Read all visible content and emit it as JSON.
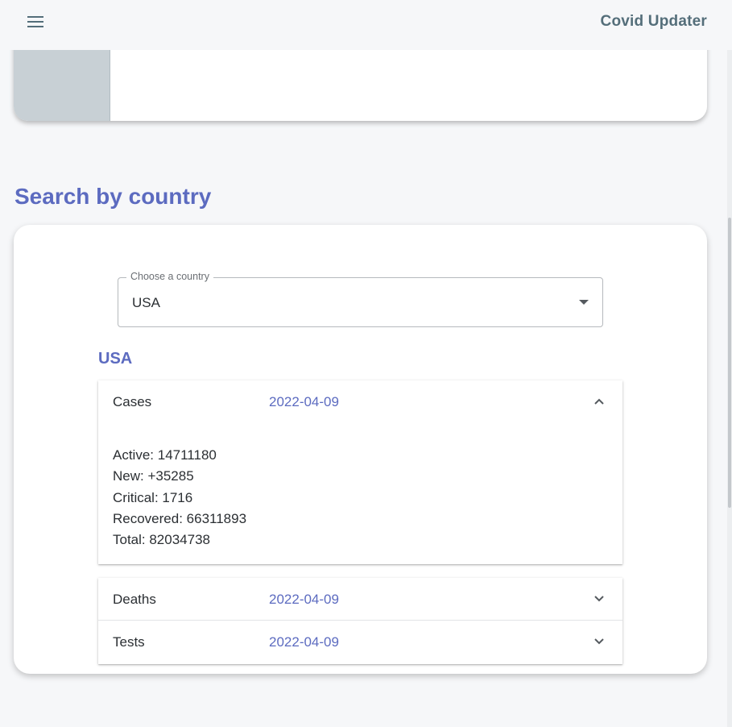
{
  "app": {
    "title": "Covid Updater",
    "menu_icon": "hamburger-menu-icon"
  },
  "colors": {
    "accent": "#5c6bc0",
    "app_title": "#546e7a",
    "background": "#f6f7f9",
    "top_swatch": "#c8d0d5"
  },
  "search": {
    "section_title": "Search by country",
    "select_label": "Choose a country",
    "select_value": "USA",
    "country_heading": "USA"
  },
  "panels": [
    {
      "title": "Cases",
      "date": "2022-04-09",
      "expanded": true,
      "stats": [
        "Active: 14711180",
        "New: +35285",
        "Critical: 1716",
        "Recovered: 66311893",
        "Total: 82034738"
      ]
    },
    {
      "title": "Deaths",
      "date": "2022-04-09",
      "expanded": false
    },
    {
      "title": "Tests",
      "date": "2022-04-09",
      "expanded": false
    }
  ]
}
